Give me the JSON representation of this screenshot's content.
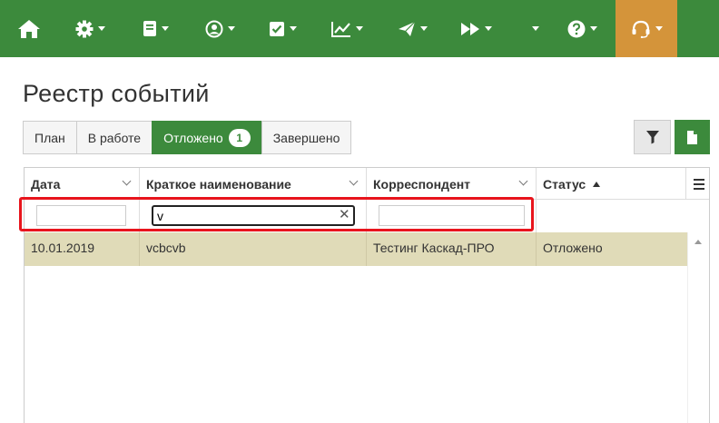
{
  "navbar": {
    "bg_color": "#3c8a3c",
    "active_color": "#d4943a",
    "items": [
      {
        "icon": "home-icon",
        "has_caret": false
      },
      {
        "icon": "gear-icon",
        "has_caret": true
      },
      {
        "icon": "book-icon",
        "has_caret": true
      },
      {
        "icon": "user-circle-icon",
        "has_caret": true
      },
      {
        "icon": "checkbox-icon",
        "has_caret": true
      },
      {
        "icon": "chart-line-icon",
        "has_caret": true
      },
      {
        "icon": "paper-plane-icon",
        "has_caret": true
      },
      {
        "icon": "fast-forward-icon",
        "has_caret": true
      },
      {
        "icon": "empty-menu",
        "has_caret": true
      },
      {
        "icon": "question-circle-icon",
        "has_caret": true
      },
      {
        "icon": "headset-icon",
        "has_caret": true,
        "active": true
      }
    ]
  },
  "page": {
    "title": "Реестр событий"
  },
  "tabs": [
    {
      "label": "План",
      "active": false
    },
    {
      "label": "В работе",
      "active": false
    },
    {
      "label": "Отложено",
      "active": true,
      "badge": "1"
    },
    {
      "label": "Завершено",
      "active": false
    }
  ],
  "toolbar": {
    "filter_icon": "filter-icon",
    "export_icon": "file-icon"
  },
  "grid": {
    "columns": [
      {
        "label": "Дата",
        "menu": true
      },
      {
        "label": "Краткое наименование",
        "menu": true
      },
      {
        "label": "Корреспондент",
        "menu": true
      },
      {
        "label": "Статус",
        "sort": "asc"
      }
    ],
    "filters": {
      "date": "",
      "short_name": "v",
      "correspondent": ""
    },
    "rows": [
      {
        "date": "10.01.2019",
        "short_name": "vcbcvb",
        "correspondent": "Тестинг Каскад-ПРО",
        "status": "Отложено"
      }
    ],
    "row_color": "#e0dbb8"
  }
}
